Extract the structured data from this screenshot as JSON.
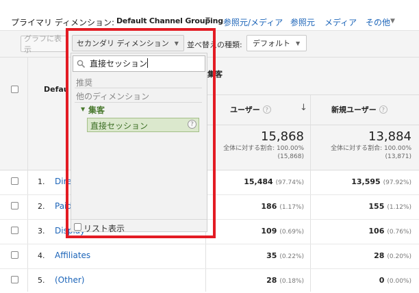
{
  "top": {
    "primary_label": "プライマリ ディメンション:",
    "primary_value": "Default Channel Grouping",
    "links": [
      "参照元/メディア",
      "参照元",
      "メディア",
      "その他"
    ]
  },
  "toolbar": {
    "graph_label": "グラフに表示",
    "secondary_label": "セカンダリ ディメンション",
    "sort_label": "並べ替えの種類:",
    "sort_value": "デフォルト"
  },
  "dropdown": {
    "search_value": "直接セッション",
    "section_recommended": "推奨",
    "section_other": "他のディメンション",
    "group_label": "集客",
    "item_label": "直接セッション",
    "item_help": "?",
    "list_view_label": "リスト表示"
  },
  "table": {
    "dimension_header": "Default Channel Grouping",
    "group_header": "集客",
    "columns": [
      "ユーザー",
      "新規ユーザー"
    ],
    "totals": {
      "users": "15,868",
      "users_note": "全体に対する割合: 100.00%",
      "users_base": "(15,868)",
      "new_users": "13,884",
      "new_users_note": "全体に対する割合: 100.00%",
      "new_users_base": "(13,871)"
    },
    "rows": [
      {
        "idx": "1.",
        "name": "Direct",
        "users": "15,484",
        "users_pct": "(97.74%)",
        "new": "13,595",
        "new_pct": "(97.92%)"
      },
      {
        "idx": "2.",
        "name": "Paid Search",
        "users": "186",
        "users_pct": "(1.17%)",
        "new": "155",
        "new_pct": "(1.12%)"
      },
      {
        "idx": "3.",
        "name": "Display",
        "users": "109",
        "users_pct": "(0.69%)",
        "new": "106",
        "new_pct": "(0.76%)"
      },
      {
        "idx": "4.",
        "name": "Affiliates",
        "users": "35",
        "users_pct": "(0.22%)",
        "new": "28",
        "new_pct": "(0.20%)"
      },
      {
        "idx": "5.",
        "name": "(Other)",
        "users": "28",
        "users_pct": "(0.18%)",
        "new": "0",
        "new_pct": "(0.00%)"
      }
    ]
  },
  "colors": {
    "link": "#1a63b8",
    "highlight_frame": "#e31b23",
    "selected_item": "#dbe8cd"
  }
}
